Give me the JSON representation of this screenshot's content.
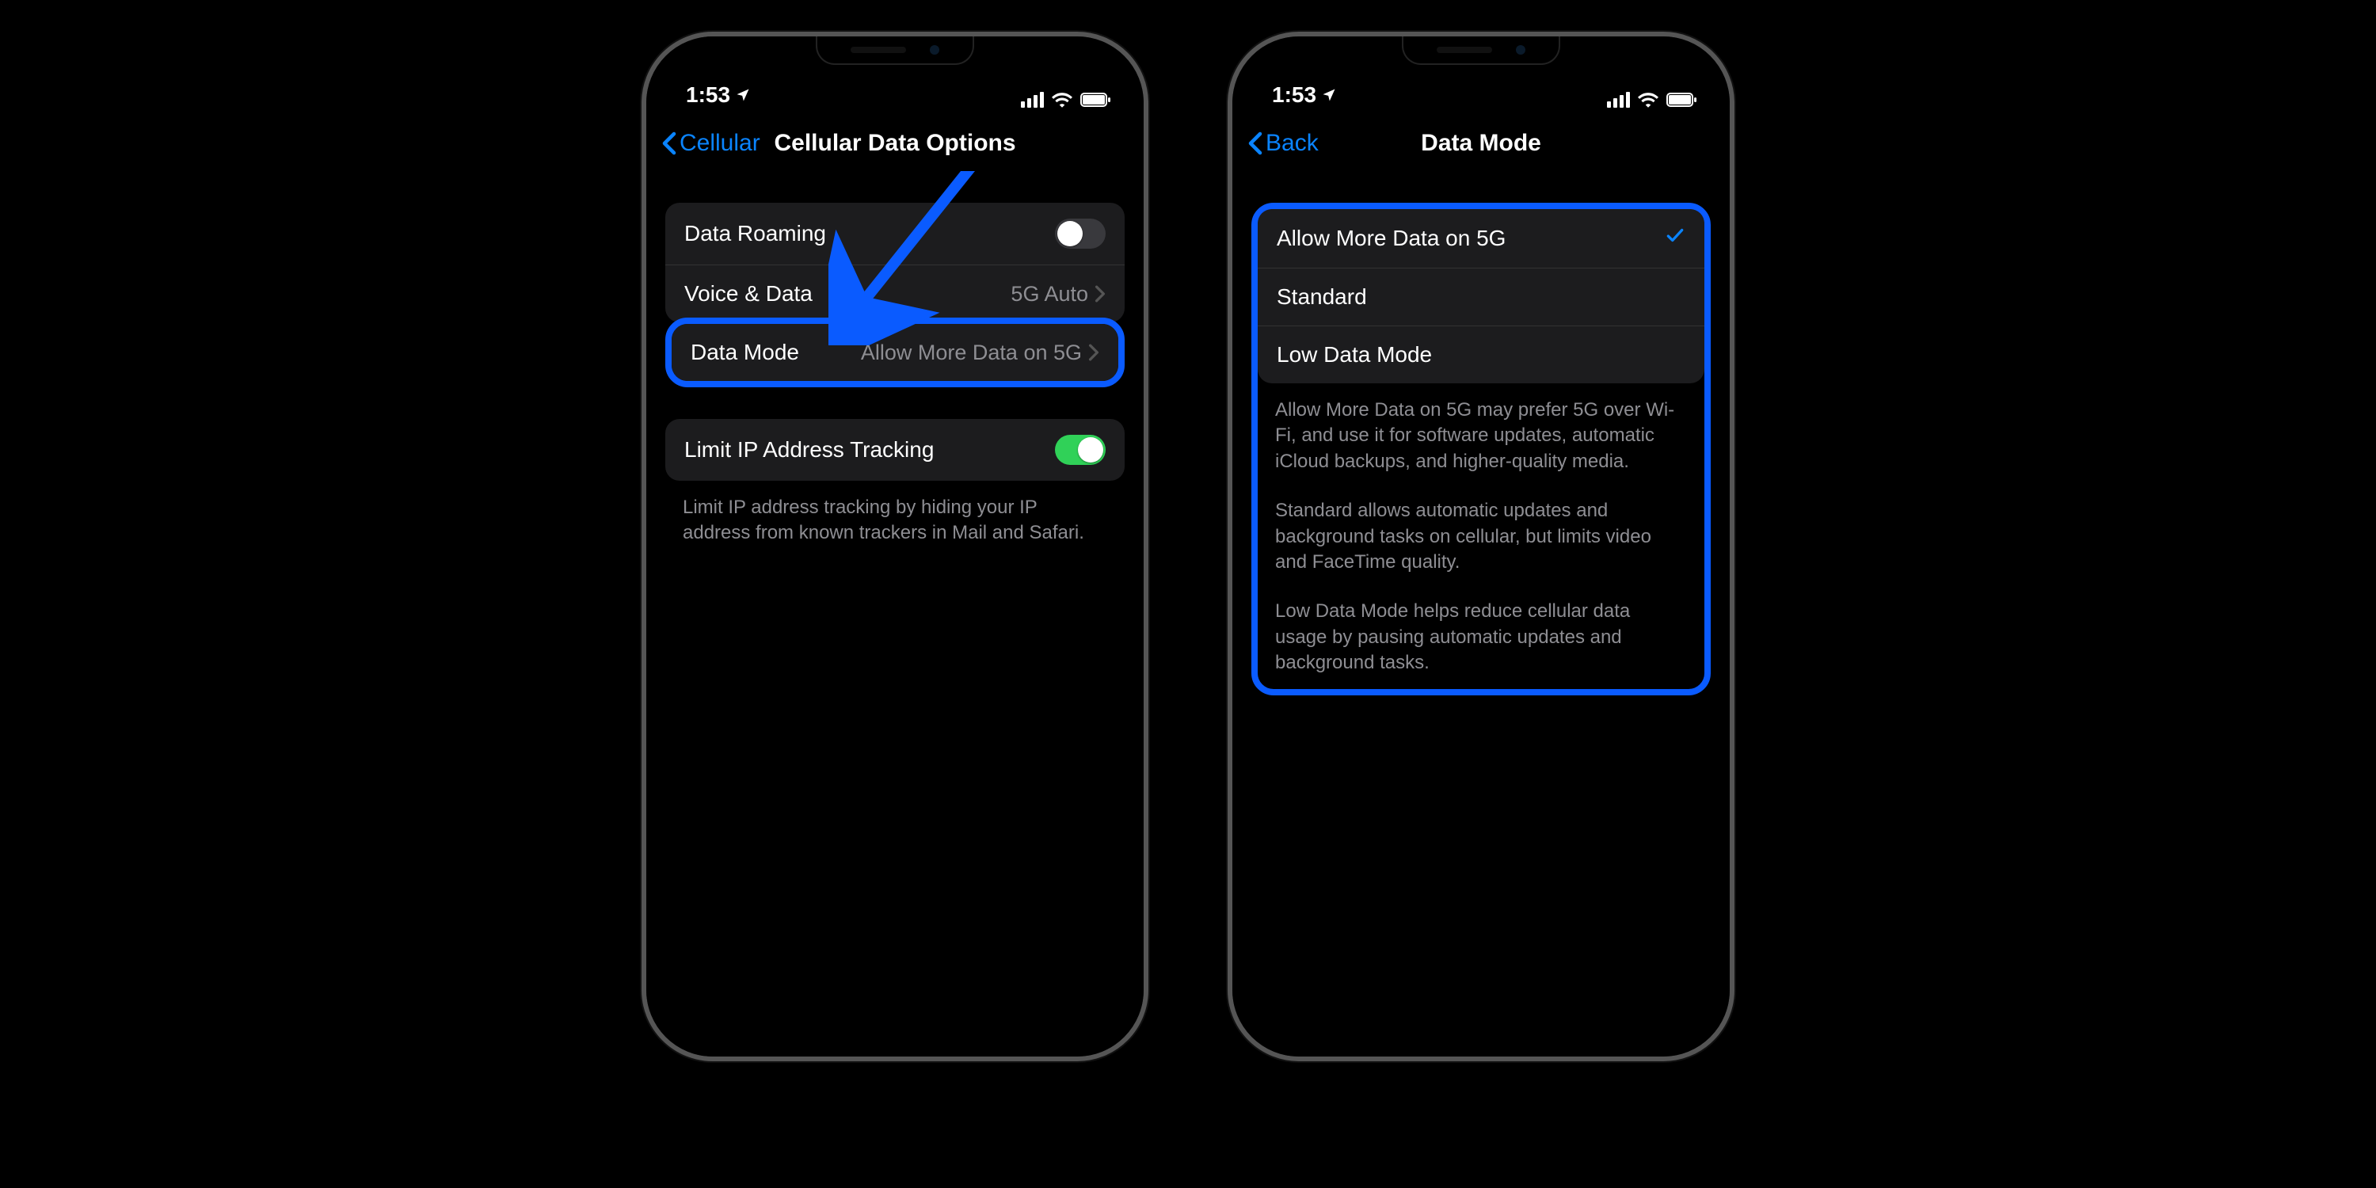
{
  "status": {
    "time": "1:53"
  },
  "left": {
    "back_label": "Cellular",
    "title": "Cellular Data Options",
    "rows": {
      "roaming": "Data Roaming",
      "voice_data": "Voice & Data",
      "voice_data_value": "5G Auto",
      "data_mode": "Data Mode",
      "data_mode_value": "Allow More Data on 5G",
      "limit_ip": "Limit IP Address Tracking"
    },
    "footer": "Limit IP address tracking by hiding your IP address from known trackers in Mail and Safari."
  },
  "right": {
    "back_label": "Back",
    "title": "Data Mode",
    "options": {
      "o1": "Allow More Data on 5G",
      "o2": "Standard",
      "o3": "Low Data Mode"
    },
    "desc1": "Allow More Data on 5G may prefer 5G over Wi-Fi, and use it for software updates, automatic iCloud backups, and higher-quality media.",
    "desc2": "Standard allows automatic updates and background tasks on cellular, but limits video and FaceTime quality.",
    "desc3": "Low Data Mode helps reduce cellular data usage by pausing automatic updates and background tasks."
  }
}
